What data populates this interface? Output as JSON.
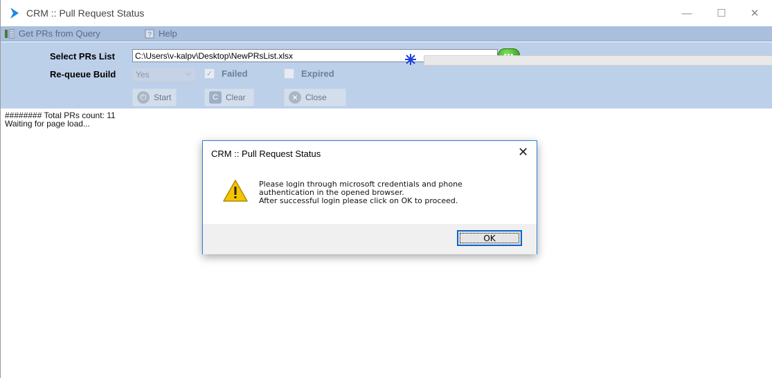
{
  "window": {
    "title": "CRM :: Pull Request Status",
    "minimize": "—",
    "maximize": "☐",
    "close": "✕"
  },
  "menu": {
    "items": [
      {
        "label": "Get PRs from Query",
        "icon": "list-icon"
      },
      {
        "label": "Help",
        "icon": "help-icon"
      }
    ]
  },
  "form": {
    "select_prs_label": "Select PRs List",
    "file_path": "C:\\Users\\v-kalpv\\Desktop\\NewPRsList.xlsx",
    "browse_label": "•••",
    "requeue_label": "Re-queue Build",
    "requeue_value": "Yes",
    "failed_label": "Failed",
    "failed_checked": true,
    "expired_label": "Expired",
    "expired_checked": false
  },
  "toolbar": {
    "start_label": "Start",
    "clear_label": "Clear",
    "close_label": "Close"
  },
  "log": {
    "lines": [
      "######## Total PRs count: 11",
      "Waiting for page load..."
    ]
  },
  "dialog": {
    "title": "CRM :: Pull Request Status",
    "close": "✕",
    "message_lines": [
      "Please login through microsoft credentials and phone",
      "authentication in the opened browser.",
      "After successful login please click on OK to proceed."
    ],
    "ok_label": "OK"
  },
  "colors": {
    "panel": "#bdd0ea",
    "menubar": "#a9bfdc",
    "dialog_border": "#2d7bd6",
    "warning": "#f5c400"
  }
}
